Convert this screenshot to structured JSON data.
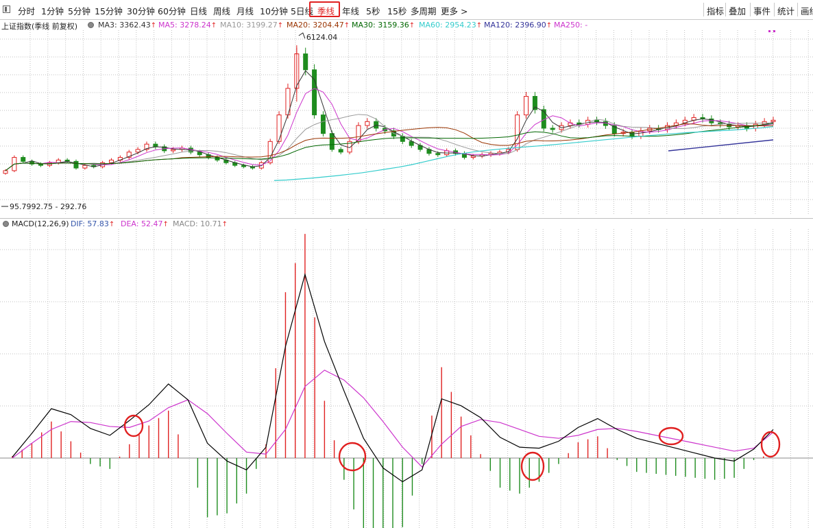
{
  "toolbar": {
    "items": [
      "分时",
      "1分钟",
      "5分钟",
      "15分钟",
      "30分钟",
      "60分钟",
      "日线",
      "周线",
      "月线",
      "10分钟",
      "5日线",
      "季线",
      "年线",
      "5秒",
      "15秒",
      "多周期",
      "更多 >"
    ],
    "active": "季线",
    "right_items": [
      "指标",
      "叠加",
      "事件",
      "统计",
      "画线"
    ]
  },
  "price_panel": {
    "legend": {
      "title": "上证指数(季线 前复权)",
      "ma": [
        {
          "label": "MA3: 3362.43",
          "color": "#333333"
        },
        {
          "label": "MA5: 3278.24",
          "color": "#cc33cc"
        },
        {
          "label": "MA10: 3199.27",
          "color": "#999999"
        },
        {
          "label": "MA20: 3204.47",
          "color": "#993300"
        },
        {
          "label": "MA30: 3159.36",
          "color": "#006600"
        },
        {
          "label": "MA60: 2954.23",
          "color": "#33cccc"
        },
        {
          "label": "MA120: 2396.90",
          "color": "#333399"
        },
        {
          "label": "MA250: -",
          "color": "#cc33cc"
        }
      ]
    },
    "high_label": "6124.04",
    "low_label": "95.7992.75 - 292.76"
  },
  "macd_panel": {
    "legend": {
      "title": "MACD(12,26,9)",
      "dif": "DIF: 57.83",
      "dea": "DEA: 52.47",
      "macd": "MACD: 10.71"
    }
  },
  "colors": {
    "up": "#e02020",
    "down": "#1e8c1e",
    "grid": "#c0c0c0",
    "dif": "#000000",
    "dea": "#cc33cc",
    "annotation": "#e02020"
  },
  "chart_data": [
    {
      "type": "line",
      "description_source": "quarterly Shanghai Composite candlesticks with moving averages (price pane)",
      "series": [
        {
          "name": "MA60",
          "values": [
            700,
            720,
            760,
            800,
            850,
            900,
            960,
            1020,
            1100,
            1180,
            1260,
            1360,
            1480,
            1600,
            1720,
            1820,
            1900,
            1960,
            2010,
            2060,
            2100,
            2140,
            2180,
            2230,
            2280,
            2330,
            2380,
            2430,
            2480,
            2530,
            2580,
            2620,
            2660,
            2700,
            2730,
            2760,
            2790,
            2820,
            2860,
            2900,
            2954
          ]
        }
      ],
      "high": 6124.04
    },
    {
      "type": "line",
      "series": [
        {
          "name": "DIF",
          "values": [
            2,
            50,
            100,
            88,
            60,
            46,
            76,
            108,
            150,
            118,
            30,
            -6,
            -24,
            22,
            226,
            372,
            236,
            136,
            40,
            -20,
            -48,
            -24,
            120,
            106,
            82,
            42,
            22,
            20,
            34,
            62,
            80,
            58,
            40,
            30,
            20,
            10,
            0,
            -6,
            18,
            57.83
          ]
        },
        {
          "name": "DEA",
          "values": [
            0,
            30,
            58,
            74,
            72,
            64,
            62,
            75,
            102,
            118,
            90,
            50,
            12,
            8,
            58,
            145,
            178,
            158,
            122,
            74,
            22,
            -18,
            28,
            64,
            78,
            72,
            58,
            44,
            40,
            46,
            58,
            60,
            54,
            46,
            38,
            30,
            22,
            14,
            20,
            52.47
          ]
        },
        {
          "name": "MACD",
          "values": [
            4,
            30,
            74,
            34,
            -12,
            -22,
            28,
            66,
            96,
            0,
            -120,
            -112,
            -72,
            28,
            336,
            454,
            116,
            -44,
            -164,
            -188,
            -140,
            -12,
            184,
            84,
            8,
            -60,
            -72,
            -48,
            -12,
            32,
            44,
            -4,
            -28,
            -32,
            -36,
            -40,
            -44,
            -40,
            -4,
            10.71
          ]
        }
      ]
    }
  ]
}
